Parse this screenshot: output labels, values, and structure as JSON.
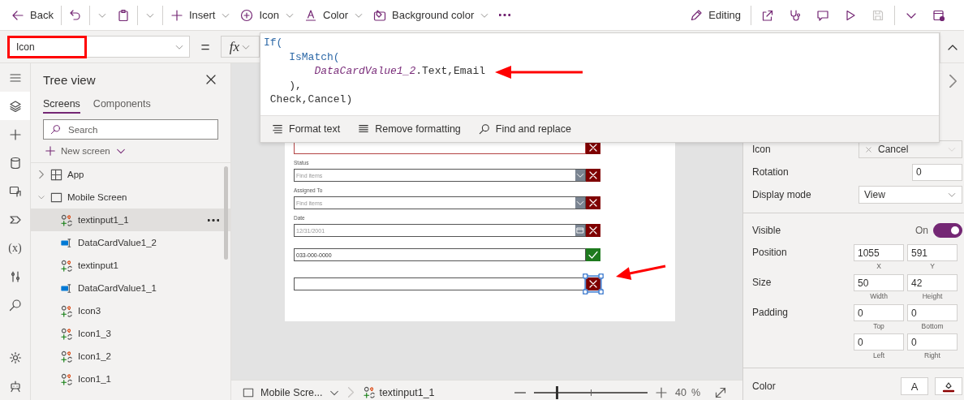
{
  "toolbar": {
    "left": [
      {
        "kind": "back",
        "label": "Back"
      },
      {
        "kind": "undo"
      },
      {
        "kind": "paste"
      },
      {
        "kind": "insert",
        "label": "Insert"
      },
      {
        "kind": "icon",
        "label": "Icon"
      },
      {
        "kind": "color",
        "label": "Color"
      },
      {
        "kind": "background",
        "label": "Background color"
      },
      {
        "kind": "more"
      }
    ],
    "right": [
      {
        "kind": "editing",
        "label": "Editing",
        "disabled": false
      },
      {
        "kind": "share",
        "disabled": false
      },
      {
        "kind": "checker",
        "disabled": false
      },
      {
        "kind": "comment",
        "disabled": false
      },
      {
        "kind": "play",
        "disabled": false
      },
      {
        "kind": "save",
        "disabled": true
      },
      {
        "kind": "caret",
        "disabled": false
      },
      {
        "kind": "publish",
        "disabled": false
      }
    ]
  },
  "formula_bar": {
    "property": "Icon",
    "equals": "=",
    "fx": "fx",
    "lines": [
      [
        {
          "text": "If(",
          "kind": "function"
        }
      ],
      [
        {
          "text": "    IsMatch(",
          "kind": "function"
        }
      ],
      [
        {
          "text": "        DataCardValue1_2",
          "kind": "control"
        },
        {
          "text": ".Text,Email",
          "kind": "plain"
        }
      ],
      [
        {
          "text": "    ),",
          "kind": "plain"
        }
      ],
      [
        {
          "text": " Check,Cancel)",
          "kind": "plain"
        }
      ]
    ],
    "actions": [
      {
        "kind": "format",
        "label": "Format text"
      },
      {
        "kind": "remove",
        "label": "Remove formatting"
      },
      {
        "kind": "find",
        "label": "Find and replace"
      }
    ]
  },
  "rail": [
    {
      "kind": "menu",
      "selected": false
    },
    {
      "kind": "layers",
      "selected": true
    },
    {
      "kind": "plus",
      "selected": false
    },
    {
      "kind": "database",
      "selected": false
    },
    {
      "kind": "media",
      "selected": false
    },
    {
      "kind": "tag",
      "selected": false
    },
    {
      "kind": "variables",
      "label": "(x)",
      "selected": false
    },
    {
      "kind": "tools",
      "selected": false
    },
    {
      "kind": "search",
      "selected": false
    },
    {
      "kind": "settings",
      "selected": false
    },
    {
      "kind": "bot",
      "selected": false
    }
  ],
  "tree": {
    "title": "Tree view",
    "tabs": [
      {
        "label": "Screens",
        "selected": true
      },
      {
        "label": "Components",
        "selected": false
      }
    ],
    "search": {
      "placeholder": "Search"
    },
    "new_screen": "New screen",
    "items": [
      {
        "kind": "app",
        "label": "App",
        "expanded": false,
        "selected": false
      },
      {
        "kind": "screen",
        "label": "Mobile Screen",
        "expanded": true,
        "selected": false,
        "children": [
          {
            "kind": "icon",
            "label": "textinput1_1",
            "selected": true
          },
          {
            "kind": "input",
            "label": "DataCardValue1_2",
            "selected": false
          },
          {
            "kind": "icon",
            "label": "textinput1",
            "selected": false
          },
          {
            "kind": "input",
            "label": "DataCardValue1_1",
            "selected": false
          },
          {
            "kind": "icon",
            "label": "Icon3",
            "selected": false
          },
          {
            "kind": "icon",
            "label": "Icon1_3",
            "selected": false
          },
          {
            "kind": "icon",
            "label": "Icon1_2",
            "selected": false
          },
          {
            "kind": "icon",
            "label": "Icon1_1",
            "selected": false
          }
        ]
      }
    ]
  },
  "canvas": {
    "fields": [
      {
        "kind": "text",
        "valid": false,
        "error": true,
        "selected": false
      },
      {
        "kind": "dropdown",
        "label": "Status",
        "placeholder": "Find items",
        "valid": false,
        "error": false,
        "selected": false
      },
      {
        "kind": "dropdown",
        "label": "Assigned To",
        "placeholder": "Find items",
        "valid": false,
        "error": false,
        "selected": false
      },
      {
        "kind": "date",
        "label": "Date",
        "placeholder": "12/31/2001",
        "valid": false,
        "error": false,
        "selected": false
      },
      {
        "kind": "text",
        "value": "033-000-0000",
        "valid": true,
        "error": false,
        "selected": false
      },
      {
        "kind": "text",
        "valid": false,
        "error": false,
        "selected": true
      }
    ]
  },
  "status_bar": {
    "screen": "Mobile Scre...",
    "control": "textinput1_1",
    "zoom": {
      "level": 0.2
    },
    "zoom_value": "40",
    "zoom_unit": "%"
  },
  "properties": {
    "sections": [
      {
        "rows": [
          {
            "kind": "icon_picker",
            "label": "Icon",
            "value": "Cancel",
            "disabled": true
          },
          {
            "kind": "number",
            "label": "Rotation",
            "value": "0"
          },
          {
            "kind": "dropdown",
            "label": "Display mode",
            "value": "View",
            "disabled": false
          }
        ]
      },
      {
        "rows": [
          {
            "kind": "toggle",
            "label": "Visible",
            "state_label": "On",
            "on": true
          },
          {
            "kind": "pair",
            "label": "Position",
            "fields": [
              {
                "value": "1055",
                "caption": "X"
              },
              {
                "value": "591",
                "caption": "Y"
              }
            ]
          },
          {
            "kind": "pair",
            "label": "Size",
            "fields": [
              {
                "value": "50",
                "caption": "Width"
              },
              {
                "value": "42",
                "caption": "Height"
              }
            ]
          },
          {
            "kind": "pair",
            "label": "Padding",
            "fields": [
              {
                "value": "0",
                "caption": "Top"
              },
              {
                "value": "0",
                "caption": "Bottom"
              },
              {
                "value": "0",
                "caption": "Left"
              },
              {
                "value": "0",
                "caption": "Right"
              }
            ]
          }
        ]
      },
      {
        "rows": [
          {
            "kind": "color",
            "label": "Color",
            "sample": "A"
          }
        ]
      }
    ]
  },
  "annotations": [
    {
      "kind": "box"
    },
    {
      "kind": "arrow"
    },
    {
      "kind": "arrow"
    }
  ]
}
